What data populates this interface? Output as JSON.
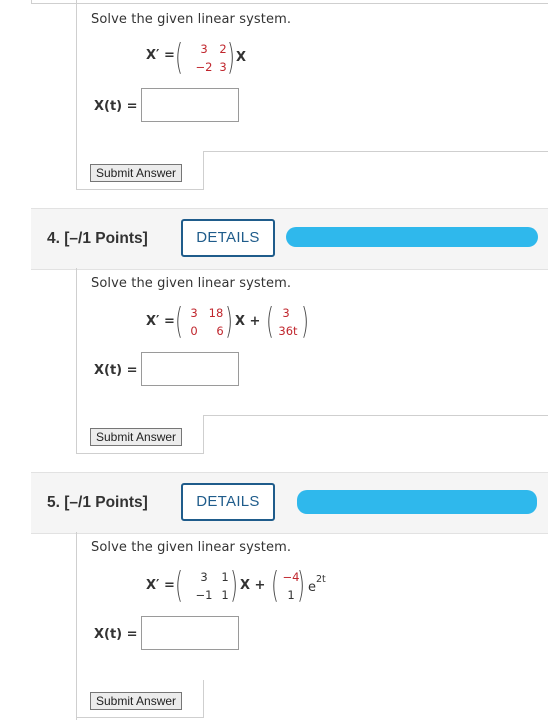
{
  "problems": [
    {
      "prompt": "Solve the given linear system.",
      "eq_lhs": "X′ =",
      "matrix": [
        "3",
        "2",
        "−2",
        "3"
      ],
      "eq_var": "X",
      "answer_label": "X(t) =",
      "answer_value": "",
      "submit_label": "Submit Answer"
    },
    {
      "number_label": "4.  [–/1 Points]",
      "details_label": "DETAILS",
      "prompt": "Solve the given linear system.",
      "eq_lhs": "X′ =",
      "matrix": [
        "3",
        "18",
        "0",
        "6"
      ],
      "eq_var": "X +",
      "vector": [
        "3",
        "36t"
      ],
      "answer_label": "X(t) =",
      "answer_value": "",
      "submit_label": "Submit Answer"
    },
    {
      "number_label": "5.  [–/1 Points]",
      "details_label": "DETAILS",
      "prompt": "Solve the given linear system.",
      "eq_lhs": "X′ =",
      "matrix": [
        "3",
        "1",
        "−1",
        "1"
      ],
      "eq_var": "X +",
      "vector": [
        "−4",
        "1"
      ],
      "exp_base": "e",
      "exp_power": "2t",
      "answer_label": "X(t) =",
      "answer_value": "",
      "submit_label": "Submit Answer"
    }
  ],
  "colors": {
    "accent": "#1f5c8b",
    "highlight_red": "#c0262d",
    "redaction": "#2fb8ec"
  }
}
